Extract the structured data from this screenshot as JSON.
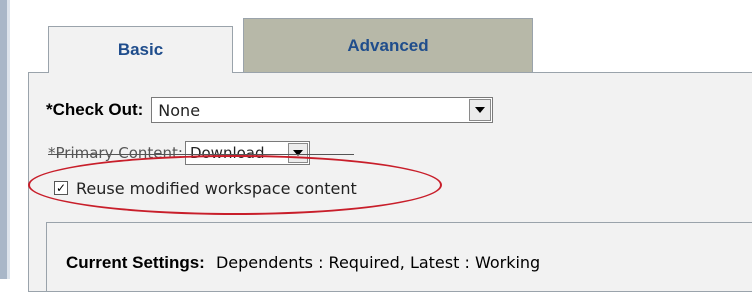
{
  "tabs": [
    {
      "label": "Basic",
      "active": true
    },
    {
      "label": "Advanced",
      "active": false
    }
  ],
  "form": {
    "checkout_label": "*Check Out:",
    "checkout_value": "None",
    "primary_label": "*Primary Content:",
    "primary_value": "Download",
    "reuse_label": "Reuse modified workspace content",
    "reuse_checked_glyph": "✓",
    "current_settings_label": "Current Settings:",
    "current_settings_value": "Dependents : Required, Latest : Working"
  },
  "colors": {
    "tab_text": "#1f4d8c",
    "advanced_tab_bg": "#b7b8a8",
    "panel_bg": "#f2f2f2",
    "highlight_ellipse": "#c81e2a"
  }
}
